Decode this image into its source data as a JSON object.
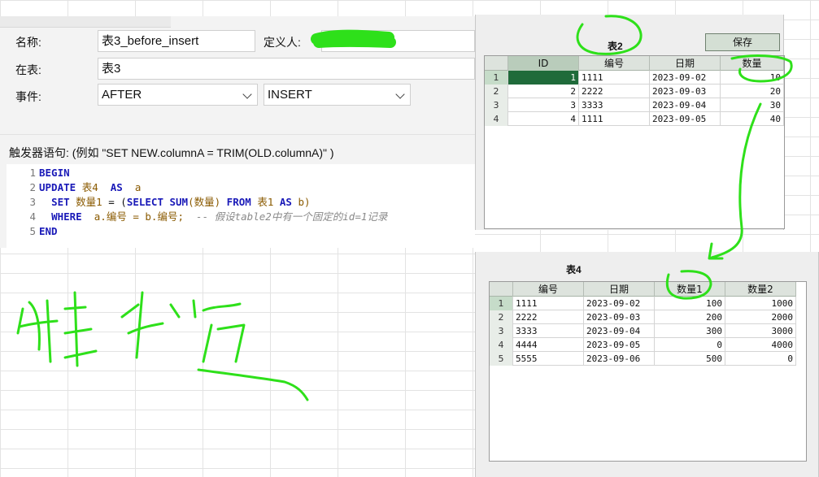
{
  "trigger": {
    "name_label": "名称:",
    "name_value": "表3_before_insert",
    "definer_label": "定义人:",
    "table_label": "在表:",
    "table_value": "表3",
    "event_label": "事件:",
    "timing_value": "AFTER",
    "event_value": "INSERT",
    "statement_hint": "触发器语句:   (例如 \"SET NEW.columnA = TRIM(OLD.columnA)\" )",
    "code": {
      "line_numbers": [
        "1",
        "2",
        "3",
        "4",
        "5"
      ],
      "l1": "BEGIN",
      "l2_kw": "UPDATE",
      "l2_table": "表4",
      "l2_as": "AS",
      "l2_alias": "a",
      "l3_set": "SET",
      "l3_col": "数量1",
      "l3_eq": "= (",
      "l3_select": "SELECT",
      "l3_sum": "SUM",
      "l3_arg": "(数量)",
      "l3_from": "FROM",
      "l3_table": "表1",
      "l3_as": "AS",
      "l3_alias": "b)",
      "l4_where": "WHERE",
      "l4_cond": "a.编号 = b.编号;",
      "l4_comment": "-- 假设table2中有一个固定的id=1记录",
      "l5": "END"
    }
  },
  "table2": {
    "title": "表2",
    "save_label": "保存",
    "columns": [
      "ID",
      "编号",
      "日期",
      "数量"
    ],
    "rows": [
      {
        "n": "1",
        "id": "1",
        "code": "1111",
        "date": "2023-09-02",
        "qty": "10"
      },
      {
        "n": "2",
        "id": "2",
        "code": "2222",
        "date": "2023-09-03",
        "qty": "20"
      },
      {
        "n": "3",
        "id": "3",
        "code": "3333",
        "date": "2023-09-04",
        "qty": "30"
      },
      {
        "n": "4",
        "id": "4",
        "code": "1111",
        "date": "2023-09-05",
        "qty": "40"
      }
    ]
  },
  "table4": {
    "title": "表4",
    "columns": [
      "编号",
      "日期",
      "数量1",
      "数量2"
    ],
    "rows": [
      {
        "n": "1",
        "code": "1111",
        "date": "2023-09-02",
        "q1": "100",
        "q2": "1000"
      },
      {
        "n": "2",
        "code": "2222",
        "date": "2023-09-03",
        "q1": "200",
        "q2": "2000"
      },
      {
        "n": "3",
        "code": "3333",
        "date": "2023-09-04",
        "q1": "300",
        "q2": "3000"
      },
      {
        "n": "4",
        "code": "4444",
        "date": "2023-09-05",
        "q1": "0",
        "q2": "4000"
      },
      {
        "n": "5",
        "code": "5555",
        "date": "2023-09-06",
        "q1": "500",
        "q2": "0"
      }
    ]
  },
  "annotations": {
    "stroke_color": "#2ee01a",
    "handwriting_text": "触发器"
  }
}
